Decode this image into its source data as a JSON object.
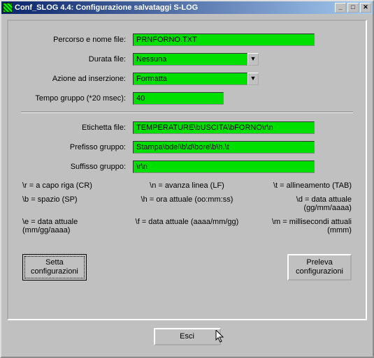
{
  "window": {
    "title": "Conf_SLOG 4.4: Configurazione salvataggi S-LOG"
  },
  "form": {
    "path_label": "Percorso e nome file:",
    "path_value": "PRNFORNO.TXT",
    "duration_label": "Durata file:",
    "duration_value": "Nessuna",
    "action_label": "Azione ad inserzione:",
    "action_value": "Formatta",
    "group_time_label": "Tempo gruppo (*20 msec):",
    "group_time_value": "40",
    "filelabel_label": "Etichetta file:",
    "filelabel_value": "TEMPERATURE\\bUSCITA\\bFORNO\\r\\n",
    "prefix_label": "Prefisso gruppo:",
    "prefix_value": "Stampa\\bdel\\b\\d\\bore\\b\\h.\\t",
    "suffix_label": "Suffisso gruppo:",
    "suffix_value": "\\r\\n"
  },
  "legend": {
    "r": "\\r = a capo riga (CR)",
    "n": "\\n = avanza linea (LF)",
    "t": "\\t = allineamento (TAB)",
    "b": "\\b = spazio (SP)",
    "h": "\\h = ora attuale (oo:mm:ss)",
    "d": "\\d = data attuale (gg/mm/aaaa)",
    "e": "\\e = data attuale (mm/gg/aaaa)",
    "f": "\\f = data attuale (aaaa/mm/gg)",
    "m": "\\m = millisecondi attuali (mmm)"
  },
  "buttons": {
    "set": "Setta\nconfigurazioni",
    "get": "Preleva\nconfigurazioni",
    "exit": "Esci"
  }
}
